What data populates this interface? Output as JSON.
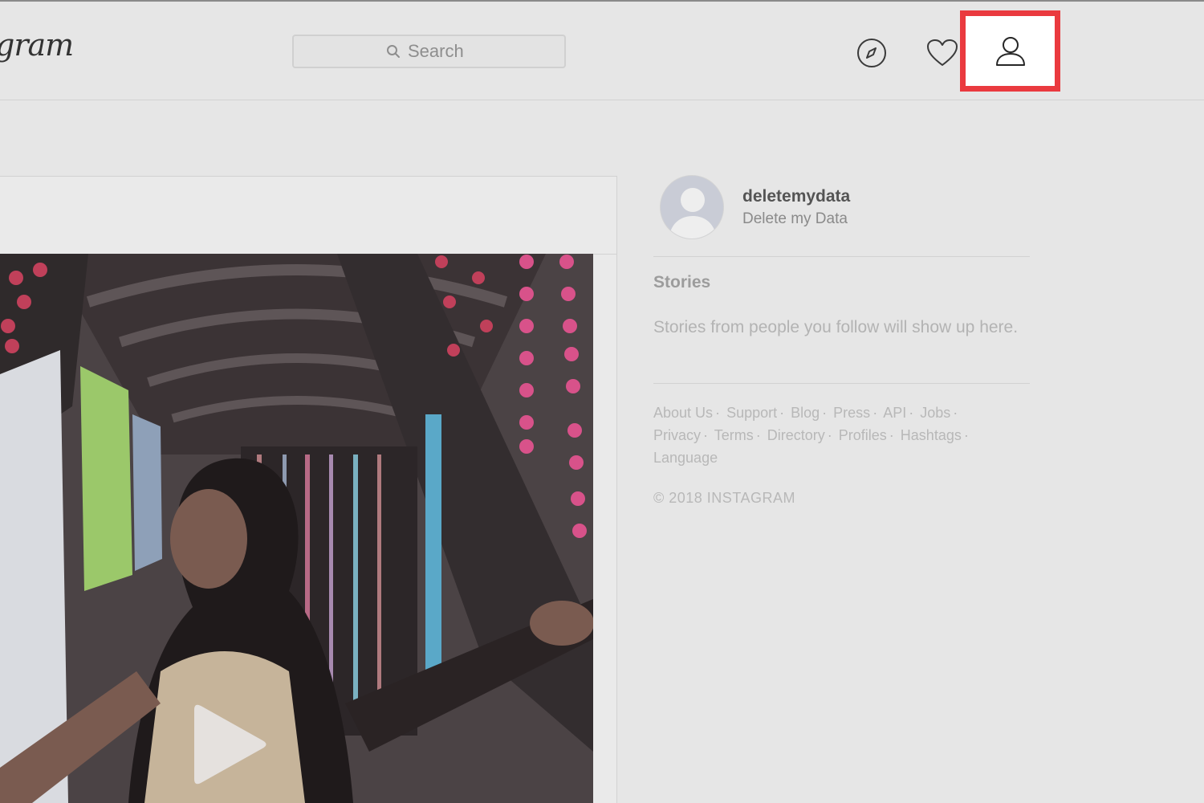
{
  "header": {
    "logo_text": "gram",
    "search": {
      "placeholder": "Search",
      "value": ""
    },
    "icons": {
      "explore": "compass-icon",
      "activity": "heart-icon",
      "profile": "person-icon"
    },
    "highlight_color": "#ea3a3f"
  },
  "sidebar": {
    "user": {
      "username": "deletemydata",
      "full_name": "Delete my Data"
    },
    "stories": {
      "title": "Stories",
      "empty_text": "Stories from people you follow will show up here."
    },
    "footer_links": [
      "About Us",
      "Support",
      "Blog",
      "Press",
      "API",
      "Jobs",
      "Privacy",
      "Terms",
      "Directory",
      "Profiles",
      "Hashtags",
      "Language"
    ],
    "copyright": "© 2018 INSTAGRAM"
  },
  "feed": {
    "post": {
      "media_type": "video",
      "play_icon": "play-icon"
    }
  }
}
